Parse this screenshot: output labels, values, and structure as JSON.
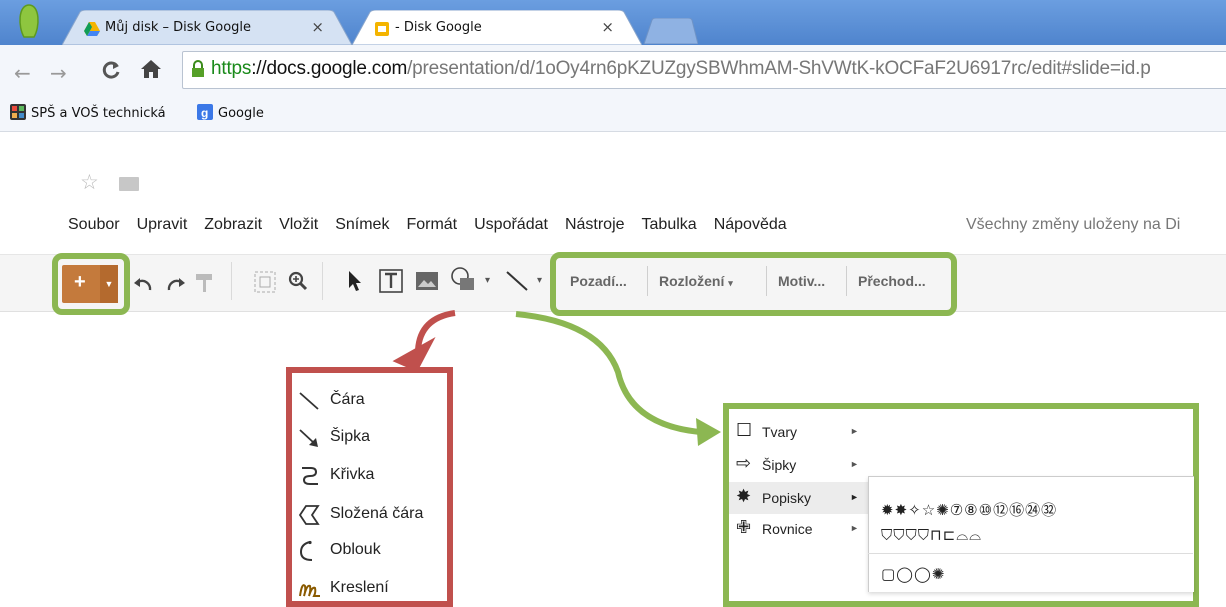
{
  "browser": {
    "tabs": [
      {
        "title": "Můj disk – Disk Google",
        "close": "×"
      },
      {
        "title": "- Disk Google",
        "close": "×"
      }
    ],
    "url": {
      "scheme": "https",
      "host": "://docs.google.com",
      "path": "/presentation/d/1oOy4rn6pKZUZgySBWhmAM-ShVWtK-kOCFaF2U6917rc/edit#slide=id.p"
    },
    "bookmarks": [
      "SPŠ a VOŠ technická",
      "Google"
    ],
    "nav_icons": [
      "back-icon",
      "forward-icon",
      "reload-icon",
      "home-icon"
    ]
  },
  "docs": {
    "menu": [
      "Soubor",
      "Upravit",
      "Zobrazit",
      "Vložit",
      "Snímek",
      "Formát",
      "Uspořádat",
      "Nástroje",
      "Tabulka",
      "Nápověda"
    ],
    "save_status": "Všechny změny uloženy na Di",
    "toolbar_text": [
      "Pozadí...",
      "Rozložení",
      "Motiv...",
      "Přechod..."
    ],
    "dropdown_caret": "▾"
  },
  "line_menu": {
    "items": [
      "Čára",
      "Šipka",
      "Křivka",
      "Složená čára",
      "Oblouk",
      "Kreslení"
    ]
  },
  "shape_menu": {
    "items": [
      {
        "label": "Tvary",
        "symbol": "☐",
        "arrow": "►"
      },
      {
        "label": "Šipky",
        "symbol": "⇨",
        "arrow": "►"
      },
      {
        "label": "Popisky",
        "symbol": "✸",
        "arrow": "►"
      },
      {
        "label": "Rovnice",
        "symbol": "✙",
        "arrow": "►"
      }
    ],
    "submenu_rows": [
      "✹✸✧☆✺⑦⑧⑩⑫⑯㉔㉜",
      "⛉⛉⛉⛉⊓⊏⌓⌓",
      "▢◯◯✺"
    ]
  },
  "colors": {
    "highlight_green": "#8cb752",
    "highlight_red": "#c0504d",
    "new_button": "#c47a3c"
  }
}
